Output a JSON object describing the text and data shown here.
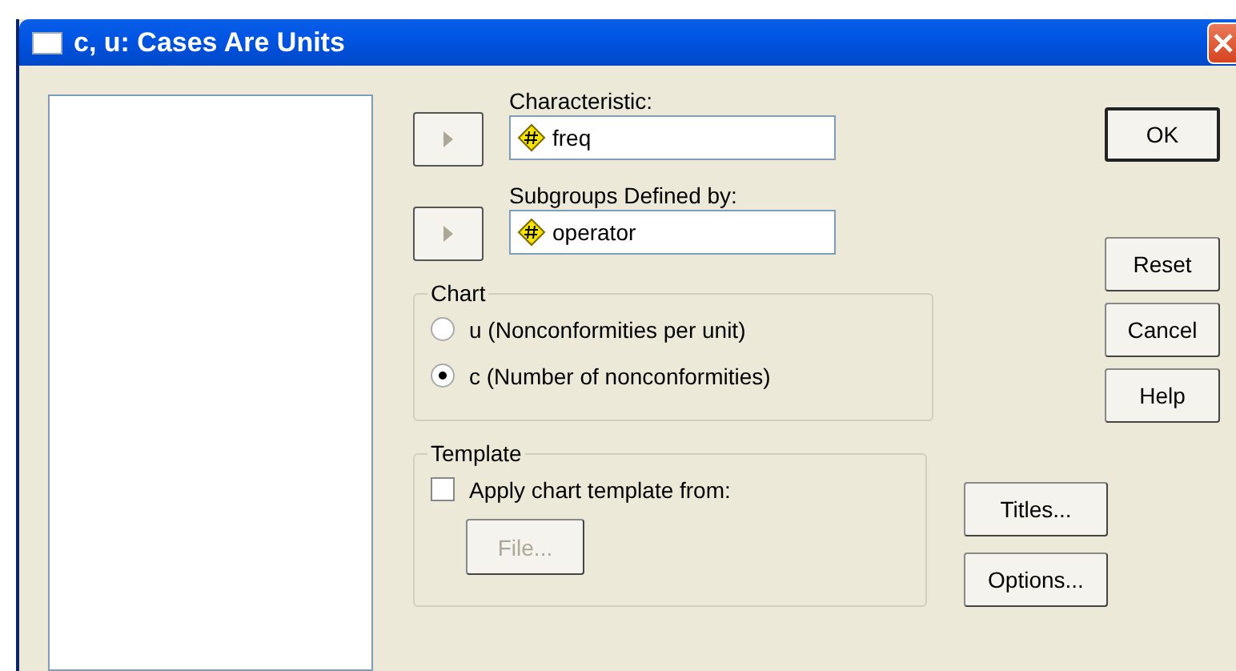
{
  "window": {
    "title": "c, u: Cases Are Units"
  },
  "fields": [
    {
      "label": "Characteristic:",
      "value": "freq"
    },
    {
      "label": "Subgroups Defined by:",
      "value": "operator"
    }
  ],
  "chart": {
    "legend": "Chart",
    "options": [
      {
        "label": "u (Nonconformities per unit)",
        "selected": false
      },
      {
        "label": "c (Number of nonconformities)",
        "selected": true
      }
    ]
  },
  "template": {
    "legend": "Template",
    "checkbox": {
      "label": "Apply chart template from:",
      "checked": false
    },
    "file_button": {
      "label": "File...",
      "disabled": true
    }
  },
  "side_buttons": [
    {
      "label": "OK",
      "default": true
    },
    {
      "label": "Reset",
      "default": false
    },
    {
      "label": "Cancel",
      "default": false
    },
    {
      "label": "Help",
      "default": false
    }
  ],
  "lower_buttons": [
    {
      "label": "Titles..."
    },
    {
      "label": "Options..."
    }
  ]
}
